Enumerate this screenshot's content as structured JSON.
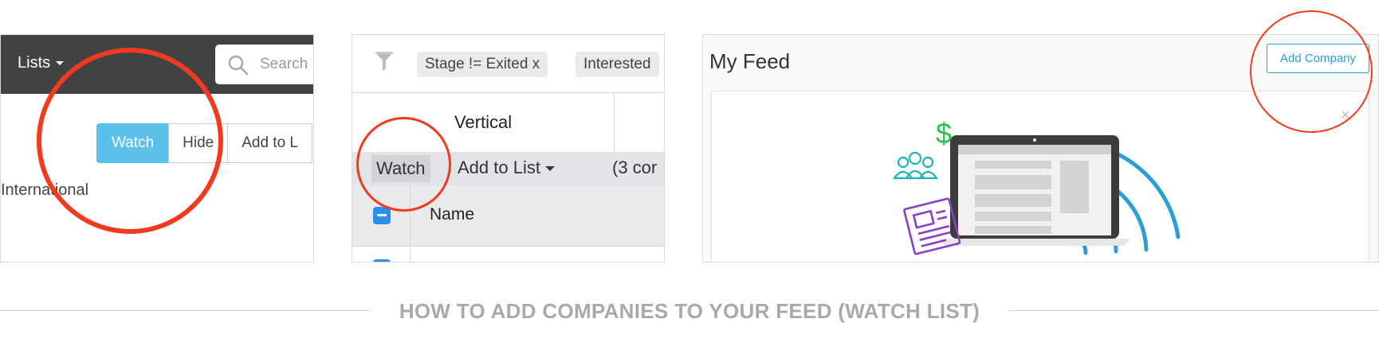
{
  "panel1": {
    "lists_label": "Lists",
    "search_placeholder": "Search",
    "watch_label": "Watch",
    "hide_label": "Hide",
    "add_to_list_label": "Add to L",
    "row_text": "International"
  },
  "panel2": {
    "filter_tags": [
      "Stage != Exited x",
      "Interested"
    ],
    "column_header": "Vertical",
    "watch_label": "Watch",
    "add_to_list_label": "Add to List",
    "count_text": "(3 cor",
    "name_header": "Name"
  },
  "panel3": {
    "title": "My Feed",
    "add_company_label": "Add Company",
    "close_glyph": "×",
    "dollar_sign": "$"
  },
  "caption": "HOW TO ADD COMPANIES TO YOUR FEED (WATCH LIST)",
  "colors": {
    "highlight_circle": "#f23a1e",
    "watch_button": "#5bc0eb",
    "accent_blue": "#2a9fd6",
    "checkbox_blue": "#2a8df0",
    "dark_header": "#424242",
    "caption_gray": "#a9a9a9",
    "illustration_purple": "#8b3fc6",
    "illustration_teal": "#1fb5b5",
    "illustration_green": "#27c24c"
  }
}
